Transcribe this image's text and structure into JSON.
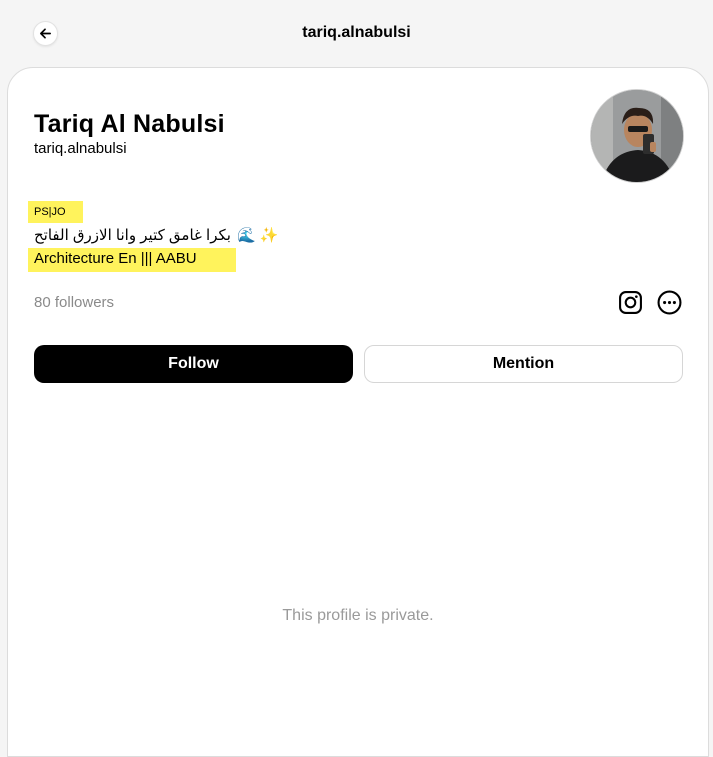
{
  "header": {
    "title": "tariq.alnabulsi",
    "back_icon": "arrow-left-icon"
  },
  "profile": {
    "name": "Tariq Al Nabulsi",
    "handle": "tariq.alnabulsi",
    "bio": {
      "line1": "PS|JO",
      "line2": "بكرا غامق كتير وانا الازرق الفاتح",
      "line2_emoji": "🌊 ✨",
      "line3": "Architecture En ||| AABU"
    },
    "followers": "80 followers",
    "highlight_color": "#fff35c"
  },
  "actions": {
    "follow_label": "Follow",
    "mention_label": "Mention",
    "instagram_icon": "instagram-icon",
    "more_icon": "more-options-icon"
  },
  "content": {
    "private_message": "This profile is private."
  }
}
